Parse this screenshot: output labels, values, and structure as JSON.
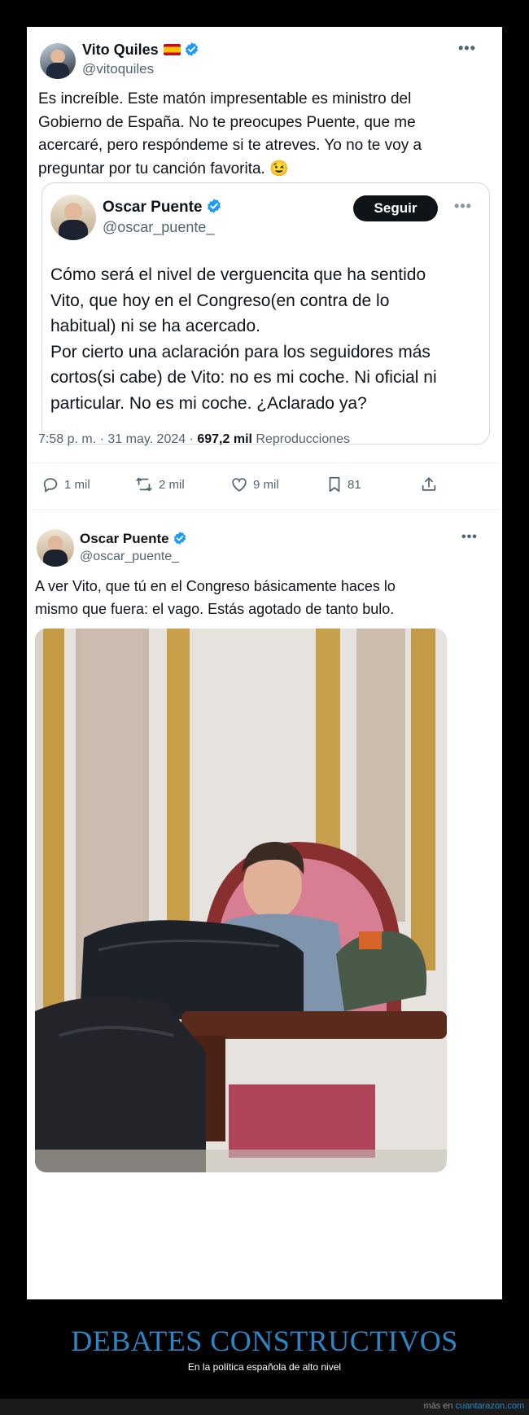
{
  "tweet1": {
    "name": "Vito Quiles",
    "handle": "@vitoquiles",
    "text_lines": [
      "Es increíble. Este matón impresentable es ministro del",
      "Gobierno de España. No te preocupes Puente, que me",
      "acercaré, pero respóndeme si te atreves. Yo no te voy a",
      "preguntar por tu canción favorita. 😉"
    ],
    "quoted": {
      "name": "Oscar Puente",
      "handle": "@oscar_puente_",
      "follow_label": "Seguir",
      "text_lines": [
        "Cómo será el nivel de verguencita que ha sentido",
        "Vito, que hoy en el Congreso(en contra de lo",
        "habitual) ni se ha acercado.",
        "Por cierto una aclaración para los seguidores más",
        "cortos(si cabe) de Vito: no es mi coche. Ni oficial ni",
        "particular. No es mi coche. ¿Aclarado ya?"
      ]
    },
    "timestamp": "7:58 p. m. · 31 may. 2024 ·",
    "views_count": "697,2 mil",
    "views_label": "Reproducciones",
    "actions": {
      "replies": "1 mil",
      "retweets": "2 mil",
      "likes": "9 mil",
      "bookmarks": "81"
    }
  },
  "tweet2": {
    "name": "Oscar Puente",
    "handle": "@oscar_puente_",
    "text_lines": [
      "A ver Vito, que tú en el Congreso básicamente haces lo",
      "mismo que fuera: el vago. Estás agotado de tanto bulo."
    ]
  },
  "caption": {
    "title": "DEBATES CONSTRUCTIVOS",
    "subtitle": "En la política española de alto nivel"
  },
  "footer": {
    "prefix": "más en",
    "site": "cuantarazon.com"
  },
  "colors": {
    "accent": "#2b86c5",
    "verified": "#1d9bf0",
    "text": "#0f1419",
    "muted": "#536471"
  }
}
